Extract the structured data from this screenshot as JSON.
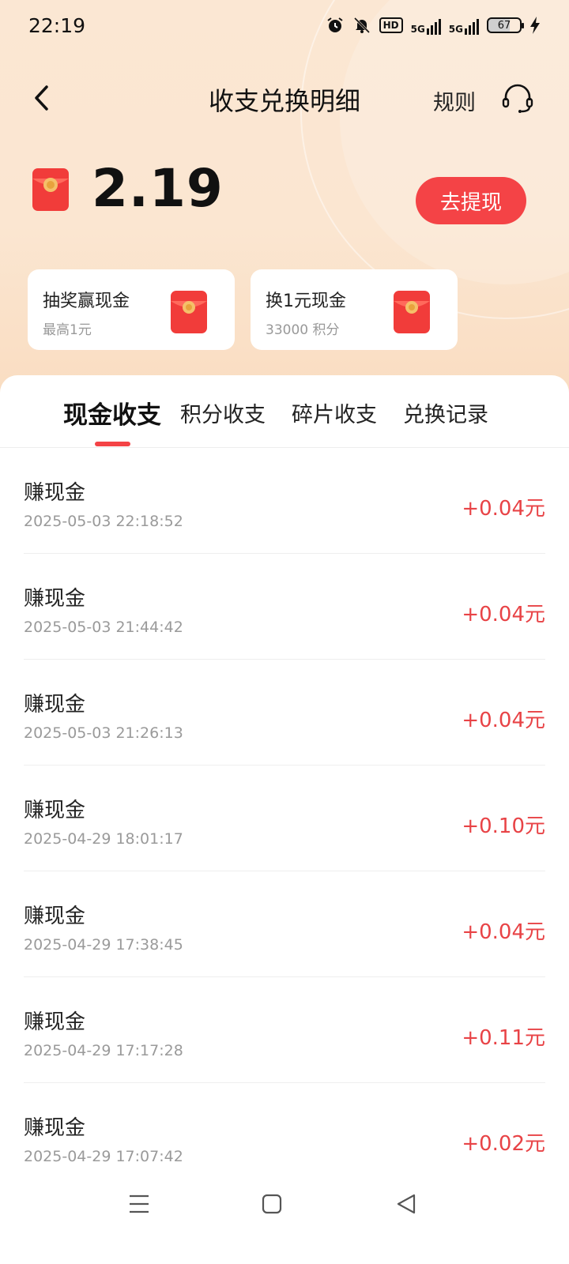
{
  "status_bar": {
    "time": "22:19",
    "battery_level": "67",
    "icons": [
      "alarm-icon",
      "mute-icon",
      "hd-icon",
      "signal-5g-icon",
      "signal-5g-icon",
      "battery-icon",
      "charging-icon"
    ],
    "hd_label": "HD",
    "network_label": "5G"
  },
  "header": {
    "title": "收支兑换明细",
    "rules_label": "规则"
  },
  "balance": {
    "amount": "2.19",
    "withdraw_label": "去提现"
  },
  "promo_cards": [
    {
      "title": "抽奖赢现金",
      "subtitle": "最高1元"
    },
    {
      "title": "换1元现金",
      "subtitle": "33000 积分"
    }
  ],
  "tabs": [
    {
      "label": "现金收支",
      "active": true
    },
    {
      "label": "积分收支",
      "active": false
    },
    {
      "label": "碎片收支",
      "active": false
    },
    {
      "label": "兑换记录",
      "active": false
    }
  ],
  "transactions": [
    {
      "title": "赚现金",
      "time": "2025-05-03 22:18:52",
      "amount": "+0.04元"
    },
    {
      "title": "赚现金",
      "time": "2025-05-03 21:44:42",
      "amount": "+0.04元"
    },
    {
      "title": "赚现金",
      "time": "2025-05-03 21:26:13",
      "amount": "+0.04元"
    },
    {
      "title": "赚现金",
      "time": "2025-04-29 18:01:17",
      "amount": "+0.10元"
    },
    {
      "title": "赚现金",
      "time": "2025-04-29 17:38:45",
      "amount": "+0.04元"
    },
    {
      "title": "赚现金",
      "time": "2025-04-29 17:17:28",
      "amount": "+0.11元"
    },
    {
      "title": "赚现金",
      "time": "2025-04-29 17:07:42",
      "amount": "+0.02元"
    }
  ],
  "colors": {
    "accent": "#f44346",
    "amount_red": "#e84346",
    "header_bg": "#fbe7d3"
  }
}
